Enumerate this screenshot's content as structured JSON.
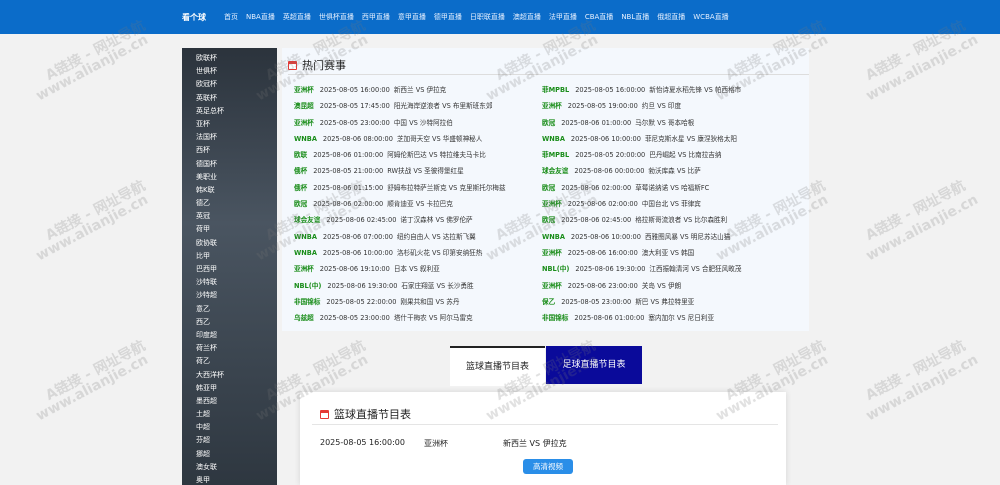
{
  "header": {
    "brand": "看个球",
    "nav": [
      "首页",
      "NBA直播",
      "英超直播",
      "世俱杯直播",
      "西甲直播",
      "意甲直播",
      "德甲直播",
      "日职联直播",
      "澳超直播",
      "法甲直播",
      "CBA直播",
      "NBL直播",
      "俄超直播",
      "WCBA直播"
    ]
  },
  "sidebar": {
    "items": [
      "欧联杯",
      "世俱杯",
      "欧冠杯",
      "英联杯",
      "英足总杯",
      "亚杯",
      "法国杯",
      "西杯",
      "德国杯",
      "美职业",
      "韩K联",
      "德乙",
      "英冠",
      "荷甲",
      "欧协联",
      "比甲",
      "巴西甲",
      "沙特联",
      "沙特超",
      "意乙",
      "西乙",
      "印度超",
      "荷兰杯",
      "荷乙",
      "大西洋杯",
      "韩亚甲",
      "墨西超",
      "土超",
      "中超",
      "芬超",
      "挪超",
      "澳女联",
      "奥甲"
    ]
  },
  "hot": {
    "title": "热门赛事",
    "left": [
      {
        "league": "亚洲杯",
        "time": "2025-08-05 16:00:00",
        "teams": "新西兰 VS 伊拉克"
      },
      {
        "league": "澳昆超",
        "time": "2025-08-05 17:45:00",
        "teams": "阳光海岸逆浪者 VS 布里斯班东郊"
      },
      {
        "league": "亚洲杯",
        "time": "2025-08-05 23:00:00",
        "teams": "中国 VS 沙特阿拉伯"
      },
      {
        "league": "WNBA",
        "time": "2025-08-06 08:00:00",
        "teams": "芝加哥天空 VS 华盛顿神秘人"
      },
      {
        "league": "欧联",
        "time": "2025-08-06 01:00:00",
        "teams": "阿姆伦斯巴达 VS 特拉维夫马卡比"
      },
      {
        "league": "俄杯",
        "time": "2025-08-05 21:00:00",
        "teams": "RW扶战 VS 圣彼得堡红星"
      },
      {
        "league": "俄杯",
        "time": "2025-08-06 01:15:00",
        "teams": "舒姆布拉特萨兰斯克 VS 克里斯托尔梅兹"
      },
      {
        "league": "欧冠",
        "time": "2025-08-06 02:00:00",
        "teams": "顺肯迪亚 VS 卡拉巴克"
      },
      {
        "league": "球会友谊",
        "time": "2025-08-06 02:45:00",
        "teams": "诺丁汉森林 VS 佛罗伦萨"
      },
      {
        "league": "WNBA",
        "time": "2025-08-06 07:00:00",
        "teams": "纽约自由人 VS 达拉斯飞翼"
      },
      {
        "league": "WNBA",
        "time": "2025-08-06 10:00:00",
        "teams": "洛杉矶火花 VS 印第安纳狂热"
      },
      {
        "league": "亚洲杯",
        "time": "2025-08-06 19:10:00",
        "teams": "日本 VS 叙利亚"
      },
      {
        "league": "NBL(中)",
        "time": "2025-08-06 19:30:00",
        "teams": "石家庄翔蓝 VS 长沙勇胜"
      },
      {
        "league": "非国锦标",
        "time": "2025-08-05 22:00:00",
        "teams": "刚果共和国 VS 苏丹"
      },
      {
        "league": "乌兹超",
        "time": "2025-08-05 23:00:00",
        "teams": "塔什干梅农 VS 阿尔马雷克"
      }
    ],
    "right": [
      {
        "league": "菲MPBL",
        "time": "2025-08-05 16:00:00",
        "teams": "新怡诗夏水稻先锋 VS 帕西格市"
      },
      {
        "league": "亚洲杯",
        "time": "2025-08-05 19:00:00",
        "teams": "约旦 VS 印度"
      },
      {
        "league": "欧冠",
        "time": "2025-08-06 01:00:00",
        "teams": "马尔默 VS 哥本哈根"
      },
      {
        "league": "WNBA",
        "time": "2025-08-06 10:00:00",
        "teams": "菲尼克斯水星 VS 康涅狄格太阳"
      },
      {
        "league": "菲MPBL",
        "time": "2025-08-05 20:00:00",
        "teams": "巴丹崛起 VS 比南拉吉纳"
      },
      {
        "league": "球会友谊",
        "time": "2025-08-06 00:00:00",
        "teams": "勃沃库森 VS 比萨"
      },
      {
        "league": "欧冠",
        "time": "2025-08-06 02:00:00",
        "teams": "草莓诺纳诺 VS 哈福斯FC"
      },
      {
        "league": "亚洲杯",
        "time": "2025-08-06 02:00:00",
        "teams": "中国台北 VS 菲律宾"
      },
      {
        "league": "欧冠",
        "time": "2025-08-06 02:45:00",
        "teams": "格拉斯哥流浪者 VS 比尔森胜利"
      },
      {
        "league": "WNBA",
        "time": "2025-08-06 10:00:00",
        "teams": "西雅图风暴 VS 明尼苏达山猫"
      },
      {
        "league": "亚洲杯",
        "time": "2025-08-06 16:00:00",
        "teams": "澳大利亚 VS 韩国"
      },
      {
        "league": "NBL(中)",
        "time": "2025-08-06 19:30:00",
        "teams": "江西振翰清河 VS 合肥狂风畋茂"
      },
      {
        "league": "亚洲杯",
        "time": "2025-08-06 23:00:00",
        "teams": "关岛 VS 伊朗"
      },
      {
        "league": "保乙",
        "time": "2025-08-05 23:00:00",
        "teams": "斯巴 VS 弗拉特里亚"
      },
      {
        "league": "非国锦标",
        "time": "2025-08-06 01:00:00",
        "teams": "塞内加尔 VS 尼日利亚"
      }
    ]
  },
  "tabs": {
    "basketball": "篮球直播节目表",
    "football": "足球直播节目表"
  },
  "panel": {
    "title": "篮球直播节目表",
    "match": {
      "time": "2025-08-05 16:00:00",
      "league": "亚洲杯",
      "teams": "新西兰 VS 伊拉克"
    },
    "hd_label": "高清视频"
  },
  "watermark": {
    "text1": "A链接 - 网址导航",
    "text2": "www.alianjie.cn"
  },
  "colors": {
    "topbar": "#0b6cc9",
    "league": "#1a8d1a",
    "active_tab": "#0a0a9a",
    "hd_button": "#2a8ee8"
  }
}
